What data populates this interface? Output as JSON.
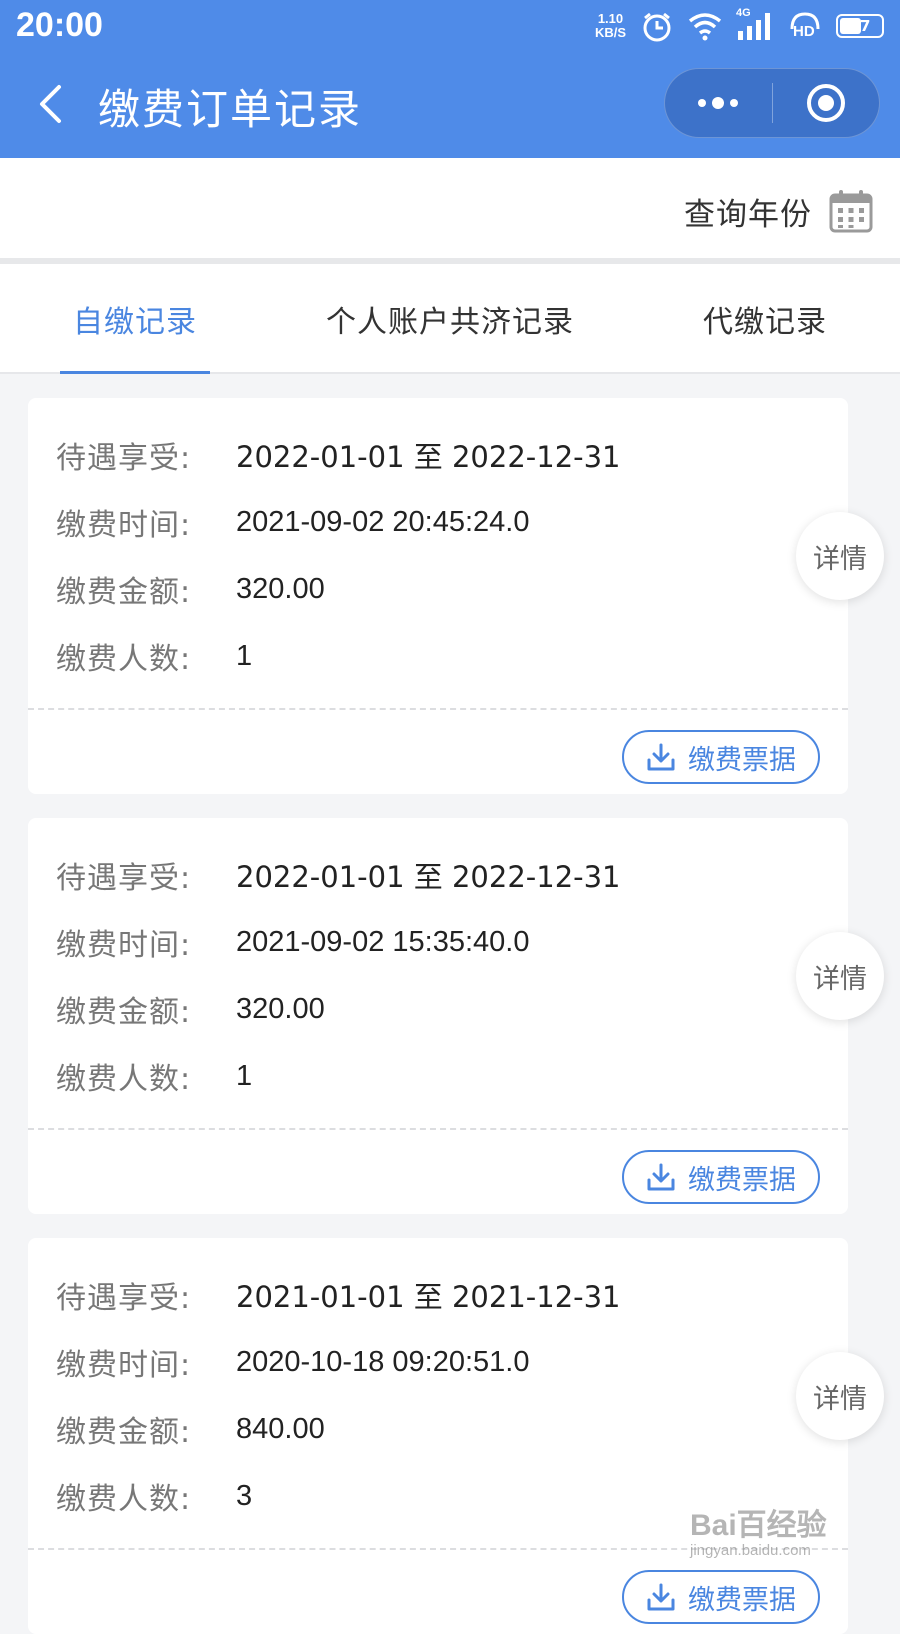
{
  "status_bar": {
    "time": "20:00",
    "net_speed_value": "1.10",
    "net_speed_unit": "KB/S",
    "network_type": "4G",
    "hd_label": "HD",
    "battery": "47"
  },
  "header": {
    "title": "缴费订单记录",
    "back_icon": "chevron-left-icon",
    "more_icon": "more-dots-icon",
    "close_icon": "target-circle-icon",
    "background_color": "#4f8be8"
  },
  "query": {
    "label": "查询年份",
    "icon": "calendar-icon"
  },
  "tabs": [
    {
      "label": "自缴记录",
      "active": true
    },
    {
      "label": "个人账户共济记录",
      "active": false
    },
    {
      "label": "代缴记录",
      "active": false
    }
  ],
  "labels": {
    "period": "待遇享受:",
    "time": "缴费时间:",
    "amount": "缴费金额:",
    "count": "缴费人数:",
    "receipt": "缴费票据",
    "detail": "详情"
  },
  "records": [
    {
      "period": "2022-01-01 至 2022-12-31",
      "time": "2021-09-02 20:45:24.0",
      "amount": "320.00",
      "count": "1"
    },
    {
      "period": "2022-01-01 至 2022-12-31",
      "time": "2021-09-02 15:35:40.0",
      "amount": "320.00",
      "count": "1"
    },
    {
      "period": "2021-01-01 至 2021-12-31",
      "time": "2020-10-18 09:20:51.0",
      "amount": "840.00",
      "count": "3"
    }
  ],
  "watermark": {
    "main": "Bai百经验",
    "sub": "jingyan.baidu.com"
  },
  "colors": {
    "accent": "#4a86e0",
    "label_gray": "#777777",
    "page_bg": "#f4f5f7"
  }
}
